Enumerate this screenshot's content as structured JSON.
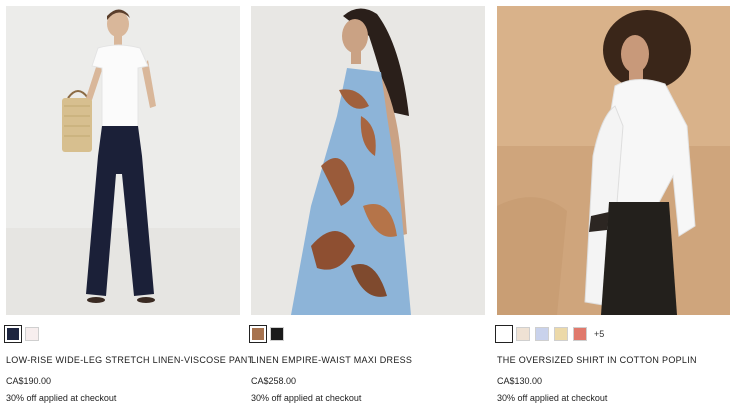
{
  "products": [
    {
      "name": "LOW-RISE WIDE-LEG STRETCH LINEN-VISCOSE PANT",
      "price": "CA$190.00",
      "promo": "30% off applied at checkout",
      "swatches": [
        {
          "color": "#1d2540",
          "selected": true,
          "name": "navy"
        },
        {
          "color": "#f7eeee",
          "selected": false,
          "name": "white"
        }
      ],
      "more_colors": ""
    },
    {
      "name": "LINEN EMPIRE-WAIST MAXI DRESS",
      "price": "CA$258.00",
      "promo": "30% off applied at checkout",
      "swatches": [
        {
          "color": "#a7734f",
          "selected": true,
          "name": "floral print"
        },
        {
          "color": "#1a1a1a",
          "selected": false,
          "name": "black"
        }
      ],
      "more_colors": ""
    },
    {
      "name": "THE OVERSIZED SHIRT IN COTTON POPLIN",
      "price": "CA$130.00",
      "promo": "30% off applied at checkout",
      "swatches": [
        {
          "color": "#ffffff",
          "selected": true,
          "name": "white"
        },
        {
          "color": "#efe2d4",
          "selected": false,
          "name": "beige stripe"
        },
        {
          "color": "#c9d2ec",
          "selected": false,
          "name": "light blue"
        },
        {
          "color": "#ecd9a9",
          "selected": false,
          "name": "tan"
        },
        {
          "color": "#e0796c",
          "selected": false,
          "name": "red stripe"
        }
      ],
      "more_colors": "+5"
    }
  ]
}
